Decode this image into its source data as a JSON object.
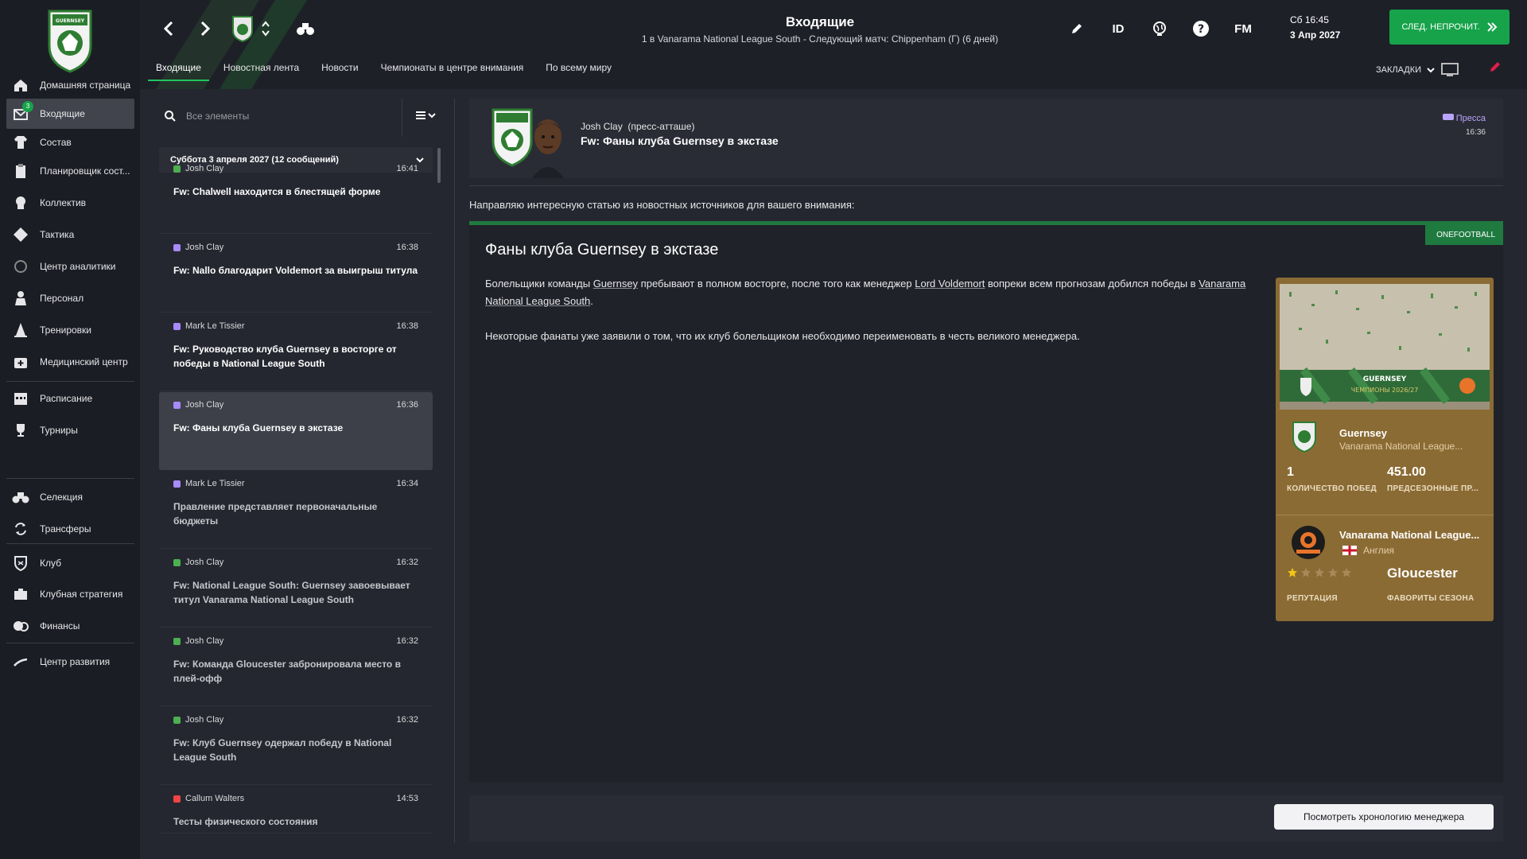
{
  "header": {
    "title": "Входящие",
    "subtitle": "1 в Vanarama National League South - Следующий матч: Chippenham (Г) (6 дней)",
    "tabs": [
      "Входящие",
      "Новостная лента",
      "Новости",
      "Чемпионаты в центре внимания",
      "По всему миру"
    ],
    "id_label": "ID",
    "fm_label": "FM",
    "date_line1": "Сб 16:45",
    "date_line2": "3 Апр 2027",
    "continue_label": "СЛЕД. НЕПРОЧИТ.",
    "bookmarks_label": "ЗАКЛАДКИ"
  },
  "sidebar": {
    "inbox_badge": "3",
    "items": [
      {
        "label": "Домашняя страница",
        "icon": "home-icon"
      },
      {
        "label": "Входящие",
        "icon": "inbox-icon"
      },
      {
        "label": "Состав",
        "icon": "shirt-icon"
      },
      {
        "label": "Планировщик сост...",
        "icon": "clipboard-icon"
      },
      {
        "label": "Коллектив",
        "icon": "dynamics-icon"
      },
      {
        "label": "Тактика",
        "icon": "tactics-icon"
      },
      {
        "label": "Центр аналитики",
        "icon": "analytics-icon"
      },
      {
        "label": "Персонал",
        "icon": "staff-icon"
      },
      {
        "label": "Тренировки",
        "icon": "training-cone-icon"
      },
      {
        "label": "Медицинский центр",
        "icon": "medical-icon"
      },
      {
        "label": "Расписание",
        "icon": "calendar-icon"
      },
      {
        "label": "Турниры",
        "icon": "trophy-icon"
      },
      {
        "label": "Селекция",
        "icon": "binoculars-icon"
      },
      {
        "label": "Трансферы",
        "icon": "transfer-icon"
      },
      {
        "label": "Клуб",
        "icon": "club-shield-icon"
      },
      {
        "label": "Клубная стратегия",
        "icon": "strategy-icon"
      },
      {
        "label": "Финансы",
        "icon": "finance-icon"
      },
      {
        "label": "Центр развития",
        "icon": "development-icon"
      }
    ]
  },
  "inbox": {
    "search_placeholder": "Все элементы",
    "group_title": "Суббота 3 апреля 2027 (12 сообщений)",
    "messages": [
      {
        "sender": "Josh Clay",
        "time": "16:41",
        "subject": "Fw: Chalwell находится в блестящей форме",
        "color": "#4caf50",
        "read": false
      },
      {
        "sender": "Josh Clay",
        "time": "16:38",
        "subject": "Fw: Nallo благодарит Voldemort за выигрыш титула",
        "color": "#a78bfa",
        "read": false
      },
      {
        "sender": "Mark Le Tissier",
        "time": "16:38",
        "subject": "Fw: Руководство клуба Guernsey в восторге от победы в National League South",
        "color": "#a78bfa",
        "read": false
      },
      {
        "sender": "Josh Clay",
        "time": "16:36",
        "subject": "Fw: Фаны клуба Guernsey в экстазе",
        "color": "#a78bfa",
        "read": false
      },
      {
        "sender": "Mark Le Tissier",
        "time": "16:34",
        "subject": "Правление представляет первоначальные бюджеты",
        "color": "#a78bfa",
        "read": true
      },
      {
        "sender": "Josh Clay",
        "time": "16:32",
        "subject": "Fw: National League South: Guernsey завоевывает титул Vanarama National League South",
        "color": "#4caf50",
        "read": true
      },
      {
        "sender": "Josh Clay",
        "time": "16:32",
        "subject": "Fw: Команда Gloucester забронировала место в плей-офф",
        "color": "#4caf50",
        "read": true
      },
      {
        "sender": "Josh Clay",
        "time": "16:32",
        "subject": "Fw: Клуб Guernsey одержал победу в National League South",
        "color": "#4caf50",
        "read": true
      },
      {
        "sender": "Callum Walters",
        "time": "14:53",
        "subject": "Тесты физического состояния",
        "color": "#ef4444",
        "read": true
      }
    ]
  },
  "detail": {
    "sender": "Josh Clay",
    "role": "(пресс-атташе)",
    "subject": "Fw: Фаны клуба Guernsey в экстазе",
    "tag": "Пресса",
    "time": "16:36",
    "intro": "Направляю интересную статью из новостных источников для вашего внимания:",
    "source": "ONEFOOTBALL",
    "article_title": "Фаны клуба Guernsey в экстазе",
    "p1_a": "Болельщики команды ",
    "p1_link1": "Guernsey",
    "p1_b": " пребывают в полном восторге, после того как менеджер ",
    "p1_link2": "Lord Voldemort",
    "p1_c": " вопреки всем прогнозам добился победы в ",
    "p1_link3": "Vanarama National League South",
    "p1_d": ".",
    "p2": "Некоторые фанаты уже заявили о том, что их клуб болельщиком необходимо переименовать в честь великого менеджера.",
    "timeline_btn": "Посмотреть хронологию менеджера"
  },
  "card": {
    "banner_name": "GUERNSEY",
    "banner_sub": "ЧЕМПИОНЫ 2026/27",
    "club_name": "Guernsey",
    "club_league": "Vanarama National League...",
    "wins": "1",
    "wins_label": "КОЛИЧЕСТВО ПОБЕД",
    "preseason": "451.00",
    "preseason_label": "ПРЕДСЕЗОННЫЕ ПР...",
    "league_name": "Vanarama National League...",
    "country": "Англия",
    "reputation_stars": 1,
    "reputation_max": 5,
    "reputation_label": "РЕПУТАЦИЯ",
    "favourite": "Gloucester",
    "favourite_label": "ФАВОРИТЫ СЕЗОНА"
  }
}
